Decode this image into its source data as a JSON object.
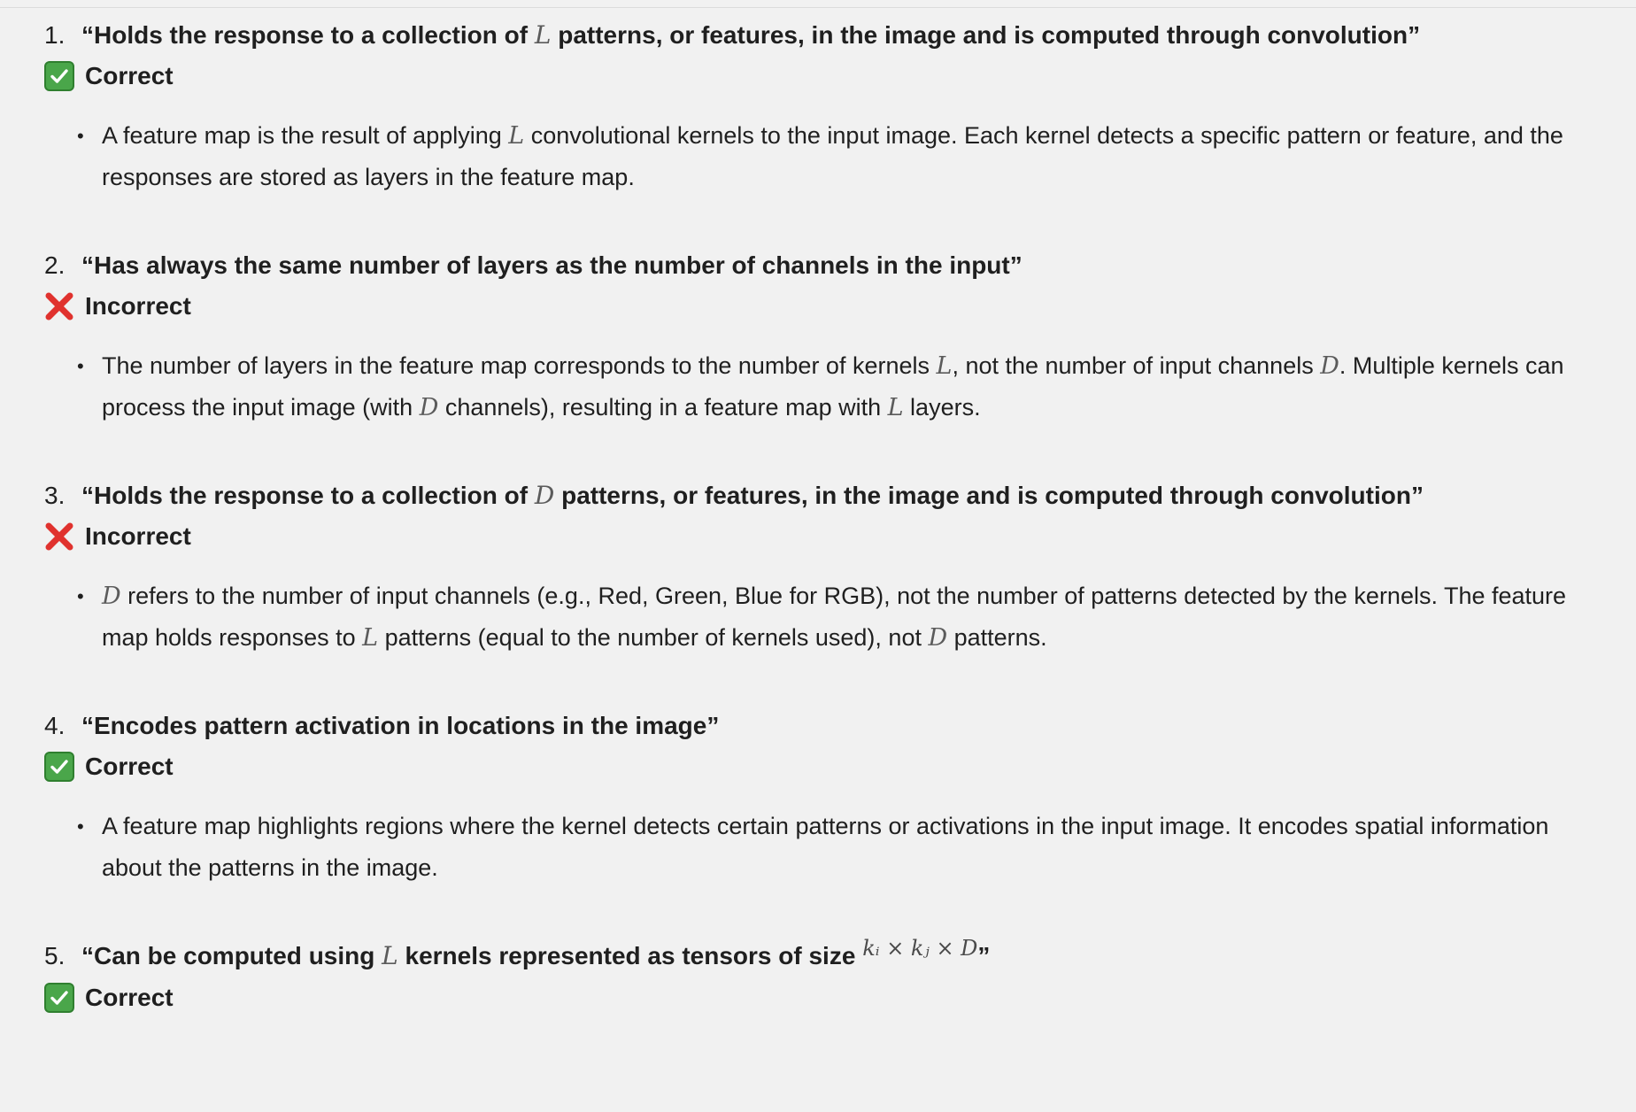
{
  "items": [
    {
      "num": "1.",
      "q_open": "“Holds the response to a collection of ",
      "q_math": "L",
      "q_close": " patterns, or features, in the image and is computed through convolution”",
      "verdict": "Correct",
      "verdict_icon": "check-mark-icon",
      "bullet": {
        "p1": "A feature map is the result of applying ",
        "m1": "L",
        "p2": " convolutional kernels to the input image. Each kernel detects a specific pattern or feature, and the responses are stored as layers in the feature map."
      }
    },
    {
      "num": "2.",
      "q_text": "“Has always the same number of layers as the number of channels in the input”",
      "verdict": "Incorrect",
      "verdict_icon": "cross-mark-icon",
      "bullet": {
        "p1": "The number of layers in the feature map corresponds to the number of kernels ",
        "m1": "L",
        "p2": ", not the number of input channels ",
        "m2": "D",
        "p3": ". Multiple kernels can process the input image (with ",
        "m3": "D",
        "p4": " channels), resulting in a feature map with ",
        "m4": "L",
        "p5": " layers."
      }
    },
    {
      "num": "3.",
      "q_open": "“Holds the response to a collection of ",
      "q_math": "D",
      "q_close": " patterns, or features, in the image and is computed through convolution”",
      "verdict": "Incorrect",
      "verdict_icon": "cross-mark-icon",
      "bullet": {
        "m1": "D",
        "p1": " refers to the number of input channels (e.g., Red, Green, Blue for RGB), not the number of patterns detected by the kernels. The feature map holds responses to ",
        "m2": "L",
        "p2": " patterns (equal to the number of kernels used), not ",
        "m3": "D",
        "p3": " patterns."
      }
    },
    {
      "num": "4.",
      "q_text": "“Encodes pattern activation in locations in the image”",
      "verdict": "Correct",
      "verdict_icon": "check-mark-icon",
      "bullet": {
        "p1": "A feature map highlights regions where the kernel detects certain patterns or activations in the input image. It encodes spatial information about the patterns in the image."
      }
    },
    {
      "num": "5.",
      "q_open": "“Can be computed using ",
      "q_math": "L",
      "q_mid": " kernels represented as tensors of size ",
      "q_sup": "kᵢ × kⱼ × D",
      "q_close": "”",
      "verdict": "Correct",
      "verdict_icon": "check-mark-icon"
    }
  ],
  "colors": {
    "correct_green": "#4aa64a",
    "incorrect_red": "#e0322e",
    "math_gray": "#5b5b5b"
  }
}
